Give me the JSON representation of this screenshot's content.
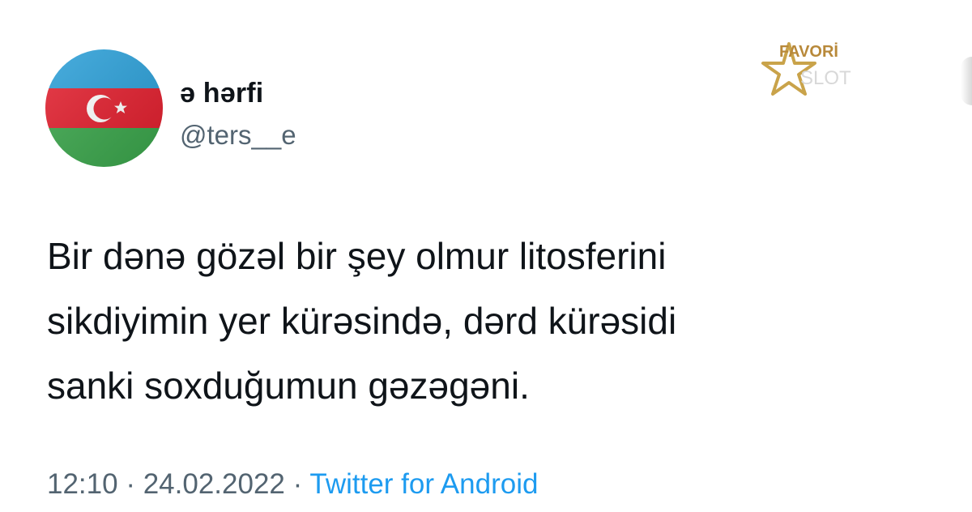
{
  "profile": {
    "display_name": "ə hərfi",
    "handle": "@ters__e",
    "avatar_icon": "azerbaijan-flag-icon"
  },
  "watermark": {
    "line1": "FAVORİ",
    "line2": "SLOT",
    "icon": "star-icon"
  },
  "tweet": {
    "lines": [
      "Bir dənə gözəl bir şey olmur litosferini",
      "sikdiyimin yer kürəsində, dərd kürəsidi",
      "sanki soxduğumun gəzəgəni."
    ]
  },
  "meta": {
    "time": "12:10",
    "separator": "·",
    "date": "24.02.2022",
    "source": "Twitter for Android"
  },
  "colors": {
    "text": "#0f1419",
    "secondary": "#536471",
    "link": "#1d9bf0",
    "flag_blue": "#2a9fd8",
    "flag_red": "#e31e2d",
    "flag_green": "#3aa64b",
    "watermark_gold": "#c9a34a"
  }
}
